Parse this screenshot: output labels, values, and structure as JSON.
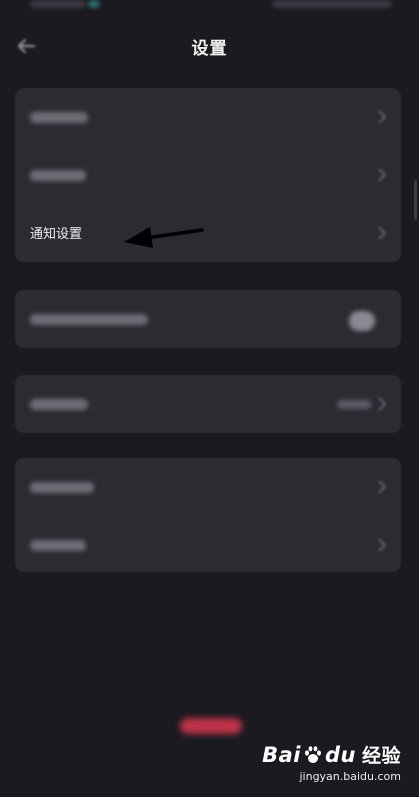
{
  "header": {
    "title": "设置"
  },
  "settings": {
    "group1": {
      "notification_label": "通知设置"
    }
  },
  "watermark": {
    "brand": "Bai",
    "brand2": "du",
    "brand_cn": "经验",
    "url": "jingyan.baidu.com"
  },
  "icons": {
    "back": "back-arrow-icon",
    "chevron": "chevron-right-icon",
    "annotation": "annotation-arrow-icon",
    "toggle": "toggle-switch"
  },
  "colors": {
    "background": "#1a1a20",
    "card": "#2b2b32",
    "accent": "#c0344a"
  }
}
